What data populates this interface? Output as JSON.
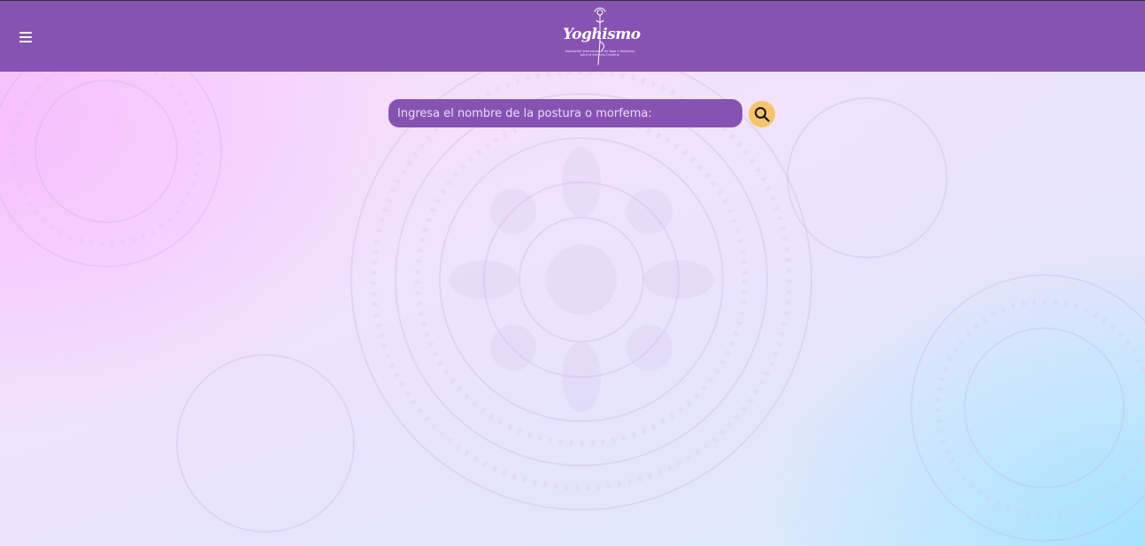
{
  "header": {
    "menu_icon": "hamburger-icon",
    "logo": {
      "wordmark": "Yoghismo",
      "tagline": "Asociación Internacional de Yoga y Yoghismo para la Armonía Corporal"
    }
  },
  "search": {
    "placeholder": "Ingresa el nombre de la postura o morfema:",
    "value": "",
    "button_icon": "search-icon"
  },
  "colors": {
    "header_bg": "#8753b2",
    "input_bg": "#8753b2",
    "search_button_bg": "#f7c46b"
  }
}
